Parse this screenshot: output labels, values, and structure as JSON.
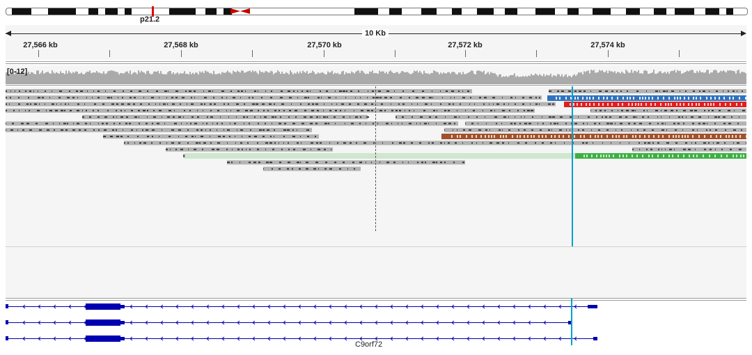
{
  "ideogram": {
    "cytoband": "p21.2",
    "selected_color": "#e00000"
  },
  "ruler": {
    "span_label": "10 Kb",
    "ticks": [
      "27,566 kb",
      "27,568 kb",
      "27,570 kb",
      "27,572 kb",
      "27,574 kb"
    ]
  },
  "coverage_track": {
    "range_label": "[0-12]",
    "color": "#aaaaaa"
  },
  "alignment_track": {
    "read_color": "#b4b4b4",
    "mismatch_colors": [
      "#2f73bf",
      "#e02020",
      "#a0522d",
      "#3cb043"
    ]
  },
  "gene_track": {
    "gene_name": "C9orf72",
    "color": "#0000b0"
  }
}
